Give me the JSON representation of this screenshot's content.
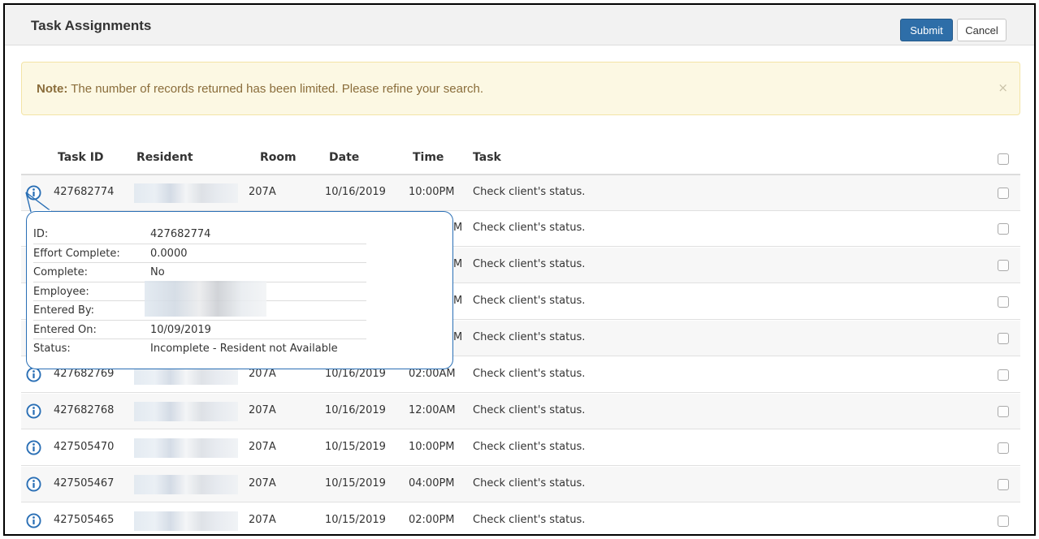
{
  "header": {
    "title": "Task Assignments",
    "submit_label": "Submit",
    "cancel_label": "Cancel"
  },
  "alert": {
    "label": "Note:",
    "message": " The number of records returned has been limited. Please refine your search.",
    "close": "×"
  },
  "table": {
    "columns": [
      "Task ID",
      "Resident",
      "Room",
      "Date",
      "Time",
      "Task"
    ],
    "rows": [
      {
        "task_id": "427682774",
        "room": "207A",
        "date": "10/16/2019",
        "time": "10:00PM",
        "task": "Check client's status."
      },
      {
        "task_id": "",
        "room": "",
        "date": "",
        "time": "M",
        "task": "Check client's status."
      },
      {
        "task_id": "",
        "room": "",
        "date": "",
        "time": "M",
        "task": "Check client's status."
      },
      {
        "task_id": "",
        "room": "",
        "date": "",
        "time": "M",
        "task": "Check client's status."
      },
      {
        "task_id": "",
        "room": "",
        "date": "",
        "time": "M",
        "task": "Check client's status."
      },
      {
        "task_id": "427682769",
        "room": "207A",
        "date": "10/16/2019",
        "time": "02:00AM",
        "task": "Check client's status."
      },
      {
        "task_id": "427682768",
        "room": "207A",
        "date": "10/16/2019",
        "time": "12:00AM",
        "task": "Check client's status."
      },
      {
        "task_id": "427505470",
        "room": "207A",
        "date": "10/15/2019",
        "time": "10:00PM",
        "task": "Check client's status."
      },
      {
        "task_id": "427505467",
        "room": "207A",
        "date": "10/15/2019",
        "time": "04:00PM",
        "task": "Check client's status."
      },
      {
        "task_id": "427505465",
        "room": "207A",
        "date": "10/15/2019",
        "time": "02:00PM",
        "task": "Check client's status."
      }
    ]
  },
  "popover": {
    "fields": [
      {
        "label": "ID:",
        "value": "427682774"
      },
      {
        "label": "Effort Complete:",
        "value": "0.0000"
      },
      {
        "label": "Complete:",
        "value": "No"
      },
      {
        "label": "Employee:",
        "value": ""
      },
      {
        "label": "Entered By:",
        "value": ""
      },
      {
        "label": "Entered On:",
        "value": "10/09/2019"
      },
      {
        "label": "Status:",
        "value": "Incomplete - Resident not Available"
      }
    ]
  },
  "colors": {
    "accent": "#2e6ea8",
    "info_icon": "#2a6fb5",
    "alert_bg": "#fcf8e3",
    "alert_text": "#8a6d3b"
  },
  "icons": [
    "info-icon",
    "close-icon",
    "checkbox"
  ]
}
